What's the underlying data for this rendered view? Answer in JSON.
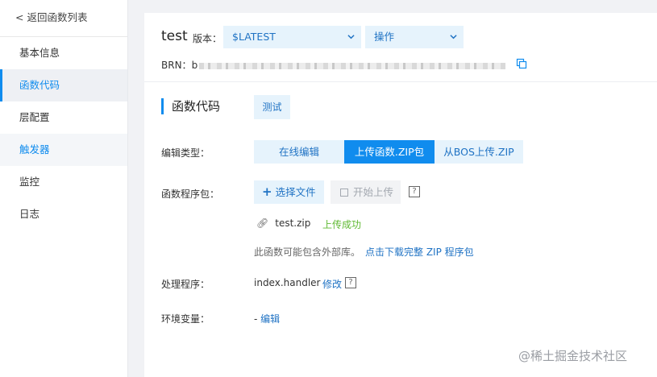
{
  "sidebar": {
    "back_label": "返回函数列表",
    "items": [
      {
        "label": "基本信息"
      },
      {
        "label": "函数代码"
      },
      {
        "label": "层配置"
      },
      {
        "label": "触发器"
      },
      {
        "label": "监控"
      },
      {
        "label": "日志"
      }
    ]
  },
  "header": {
    "function_name": "test",
    "version_label": "版本：",
    "version_value": "$LATEST",
    "operations_label": "操作",
    "brn_label": "BRN：",
    "brn_prefix": "b",
    "brn_suffix": "…7c9 f24d:function:test:$"
  },
  "code": {
    "section_title": "函数代码",
    "test_button": "测试",
    "edit_type_label": "编辑类型：",
    "edit_types": {
      "online": "在线编辑",
      "zip": "上传函数.ZIP包",
      "bos": "从BOS上传.ZIP"
    },
    "package_label": "函数程序包：",
    "choose_file_button": "选择文件",
    "start_upload_button": "开始上传",
    "help_glyph": "?",
    "file_name": "test.zip",
    "upload_status": "上传成功",
    "note_text": "此函数可能包含外部库。",
    "note_link": "点击下载完整 ZIP 程序包",
    "handler_label": "处理程序：",
    "handler_value": "index.handler",
    "modify_link": "修改",
    "env_label": "环境变量：",
    "env_dash": "-",
    "env_edit_link": "编辑"
  },
  "watermark": "@稀土掘金技术社区",
  "colors": {
    "accent": "#108cee",
    "accent_light": "#e6f3fc",
    "success": "#5fb932"
  }
}
